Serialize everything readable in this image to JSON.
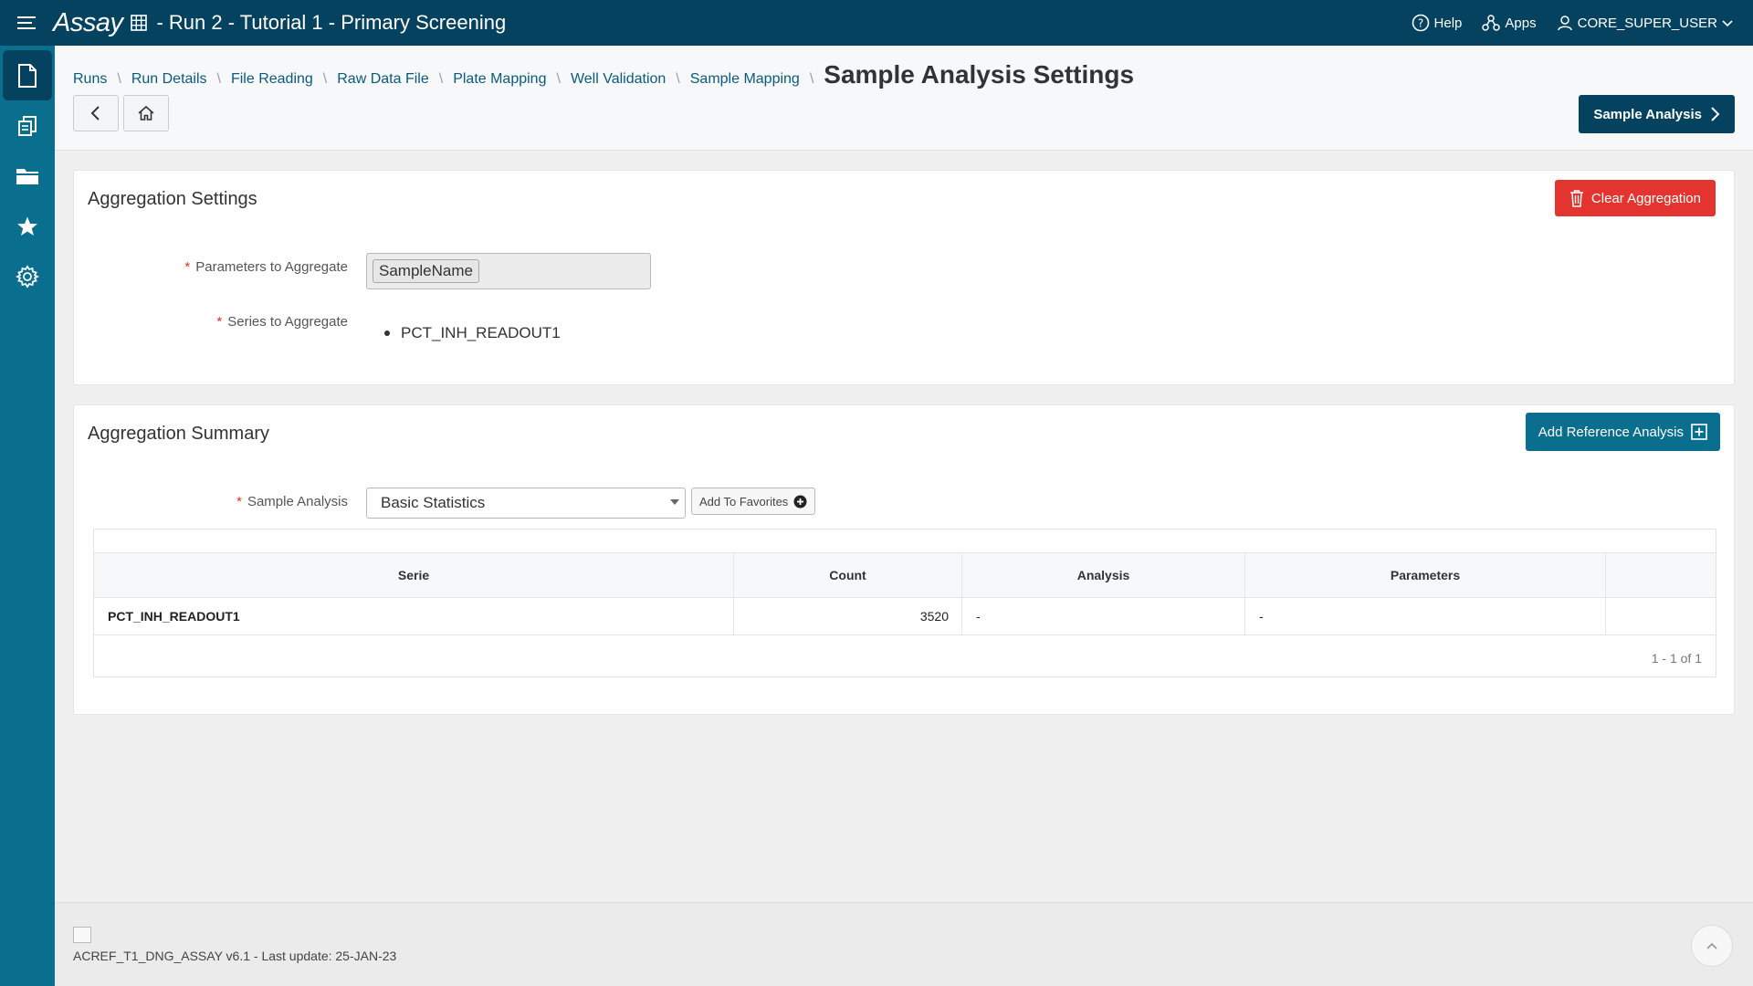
{
  "topbar": {
    "app_name": "Assay",
    "run_title": "- Run 2 - Tutorial 1 - Primary Screening",
    "help": "Help",
    "apps": "Apps",
    "user": "CORE_SUPER_USER"
  },
  "sidebar": {
    "items": [
      {
        "icon": "document-icon",
        "active": true
      },
      {
        "icon": "copy-documents-icon",
        "active": false
      },
      {
        "icon": "folder-icon",
        "active": false
      },
      {
        "icon": "star-icon",
        "active": false
      },
      {
        "icon": "gear-icon",
        "active": false
      }
    ]
  },
  "breadcrumb": {
    "items": [
      "Runs",
      "Run Details",
      "File Reading",
      "Raw Data File",
      "Plate Mapping",
      "Well Validation",
      "Sample Mapping"
    ],
    "current": "Sample Analysis Settings"
  },
  "header": {
    "primary_button": "Sample Analysis"
  },
  "aggregation_settings": {
    "title": "Aggregation Settings",
    "clear_button": "Clear Aggregation",
    "parameters_label": "Parameters to Aggregate",
    "parameters_value": "SampleName",
    "series_label": "Series to Aggregate",
    "series_items": [
      "PCT_INH_READOUT1"
    ]
  },
  "aggregation_summary": {
    "title": "Aggregation Summary",
    "add_reference_button": "Add Reference Analysis",
    "sample_analysis_label": "Sample Analysis",
    "sample_analysis_value": "Basic Statistics",
    "add_favorites_button": "Add To Favorites",
    "table": {
      "columns": [
        "Serie",
        "Count",
        "Analysis",
        "Parameters",
        ""
      ],
      "rows": [
        {
          "serie": "PCT_INH_READOUT1",
          "count": "3520",
          "analysis": "-",
          "parameters": "-"
        }
      ],
      "pager": "1 - 1 of 1"
    }
  },
  "footer": {
    "version_text": "ACREF_T1_DNG_ASSAY v6.1 - Last update: 25-JAN-23"
  },
  "colors": {
    "header_bg": "#04425f",
    "sidebar_bg": "#0a6e8f",
    "danger": "#e3342f",
    "link": "#0a5a80"
  }
}
